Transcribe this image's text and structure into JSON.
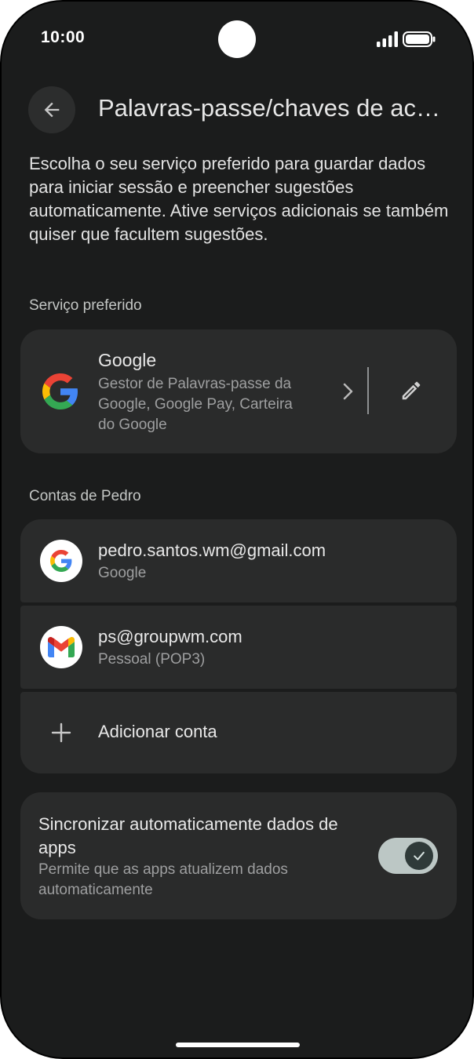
{
  "status_bar": {
    "time": "10:00"
  },
  "header": {
    "title": "Palavras-passe/chaves de acesso e contas"
  },
  "intro_text": "Escolha o seu serviço preferido para guardar dados para iniciar sessão e preencher sugestões automaticamente. Ative serviços adicionais se também quiser que facultem sugestões.",
  "preferred_service": {
    "section_label": "Serviço preferido",
    "name": "Google",
    "description": "Gestor de Palavras-passe da Google, Google Pay, Carteira do Google",
    "icon": "google-logo-icon"
  },
  "accounts": {
    "section_label": "Contas de Pedro",
    "items": [
      {
        "email": "pedro.santos.wm@gmail.com",
        "type": "Google",
        "icon": "google-logo-icon"
      },
      {
        "email": "ps@groupwm.com",
        "type": "Pessoal (POP3)",
        "icon": "gmail-icon"
      }
    ],
    "add_label": "Adicionar conta"
  },
  "sync": {
    "title": "Sincronizar automaticamente dados de apps",
    "description": "Permite que as apps atualizem dados automaticamente",
    "enabled": true
  },
  "colors": {
    "background": "#1b1c1c",
    "card": "#2a2b2b",
    "toggle_track": "#bcc7c5",
    "toggle_thumb": "#2f3a39"
  }
}
